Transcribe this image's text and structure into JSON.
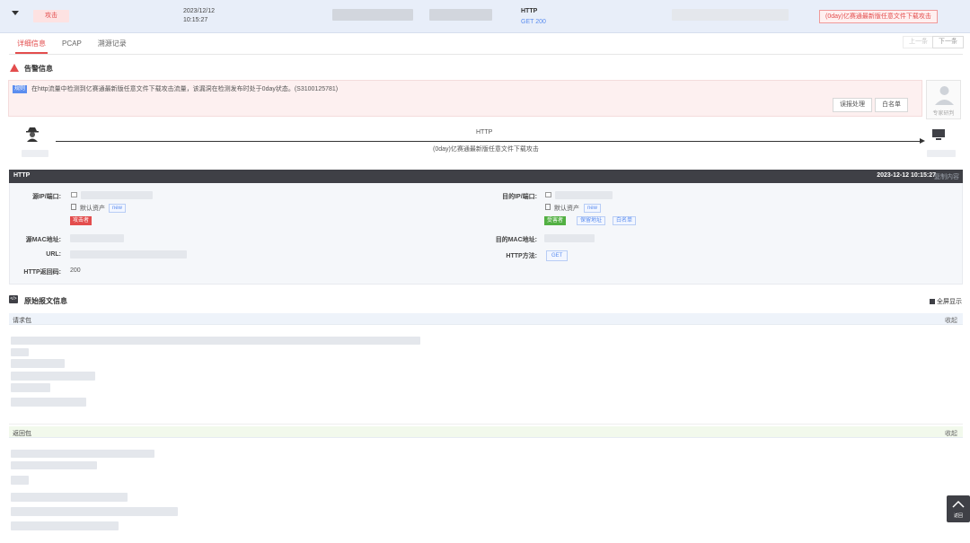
{
  "summary": {
    "attack_tag": "攻击",
    "date": "2023/12/12",
    "time": "10:15:27",
    "protocol": "HTTP",
    "method_status": "GET  200",
    "title_tag": "(0day)亿赛通最新版任意文件下载攻击"
  },
  "tabs": [
    {
      "label": "详细信息",
      "active": true
    },
    {
      "label": "PCAP",
      "active": false
    },
    {
      "label": "溯源记录",
      "active": false
    }
  ],
  "nav": {
    "prev": "上一条",
    "next": "下一条"
  },
  "alert": {
    "section_title": "告警信息",
    "badge": "规则",
    "message": "在http流量中检测到亿赛通最新版任意文件下载攻击流量，该漏洞在检测发布时处于0day状态。(S3100125781)",
    "btn_handle": "误报处理",
    "btn_whitelist": "白名单",
    "expert_label": "专家研判"
  },
  "flow": {
    "top_label": "HTTP",
    "bottom_label": "(0day)亿赛通最新版任意文件下载攻击"
  },
  "http": {
    "title": "HTTP",
    "datetime": "2023-12-12 10:15:27",
    "copy_label": "复制内容",
    "src_label": "源IP/端口:",
    "src_asset": "默认资产",
    "src_asset_tag": "new",
    "src_role": "攻击者",
    "dst_label": "目的IP/端口:",
    "dst_asset": "默认资产",
    "dst_asset_tag": "new",
    "dst_role": "受害者",
    "dst_tag2": "保留地址",
    "dst_tag3": "白名单",
    "src_mac_label": "源MAC地址:",
    "dst_mac_label": "目的MAC地址:",
    "url_label": "URL:",
    "method_label": "HTTP方法:",
    "method_value": "GET",
    "status_label": "HTTP返回码:",
    "status_value": "200"
  },
  "raw": {
    "section_title": "原始报文信息",
    "fullscreen": "全屏显示",
    "request_title": "请求包",
    "response_title": "返回包",
    "collapse": "收起",
    "backtop": "返回"
  },
  "colors": {
    "accent_red": "#e34d4d",
    "accent_blue": "#5b8def",
    "victim_green": "#52b043",
    "header_dark": "#3f4046"
  }
}
